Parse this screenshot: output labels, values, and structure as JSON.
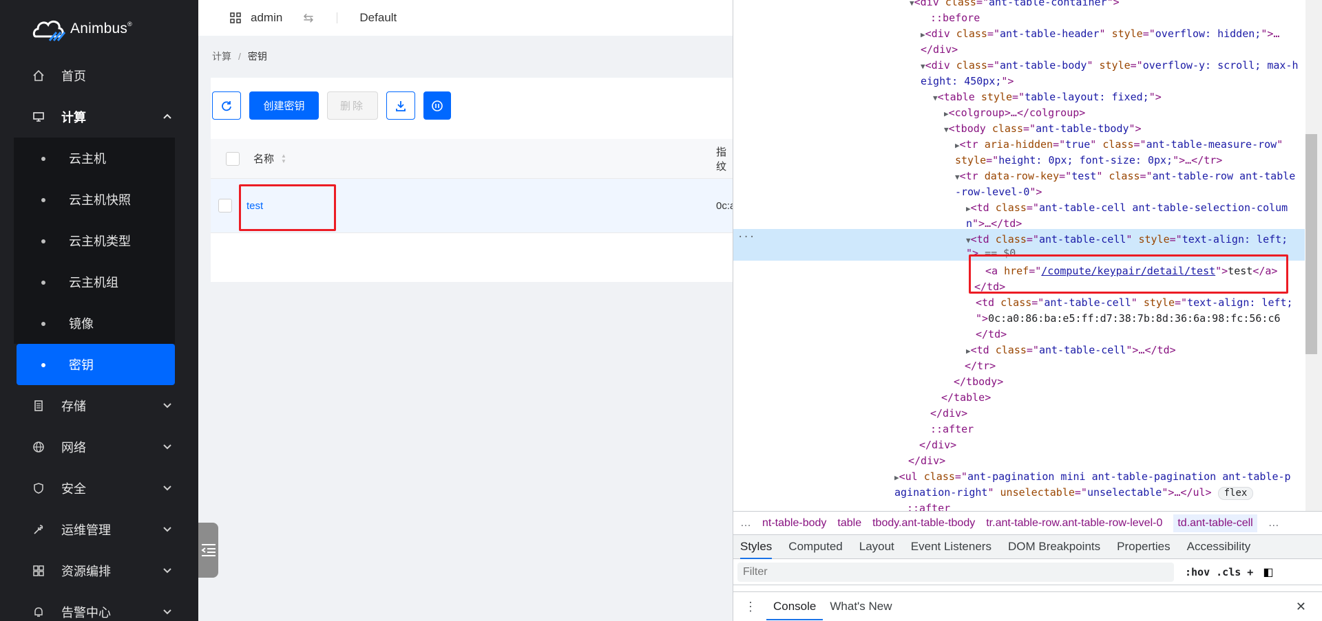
{
  "brand": {
    "name": "Animbus",
    "mark": "®"
  },
  "sidebar": {
    "items": [
      {
        "label": "首页",
        "icon": "home-icon"
      },
      {
        "label": "计算",
        "icon": "desktop-icon",
        "expanded": true
      },
      {
        "label": "存储",
        "icon": "storage-icon"
      },
      {
        "label": "网络",
        "icon": "globe-icon"
      },
      {
        "label": "安全",
        "icon": "shield-icon"
      },
      {
        "label": "运维管理",
        "icon": "wrench-icon"
      },
      {
        "label": "资源编排",
        "icon": "grid-icon"
      },
      {
        "label": "告警中心",
        "icon": "bell-icon"
      }
    ],
    "compute_sub": [
      "云主机",
      "云主机快照",
      "云主机类型",
      "云主机组",
      "镜像",
      "密钥"
    ],
    "active_sub": "密钥"
  },
  "header": {
    "user": "admin",
    "project": "Default"
  },
  "breadcrumb": {
    "parent": "计算",
    "separator": "/",
    "current": "密钥"
  },
  "toolbar": {
    "create_label": "创建密钥",
    "delete_label": "删除"
  },
  "table": {
    "columns": {
      "name": "名称",
      "fingerprint_partial": "指纹"
    },
    "rows": [
      {
        "name": "test",
        "fingerprint_partial": "0c:a"
      }
    ]
  },
  "devtools": {
    "elements": {
      "l1_class": "ant-table-container",
      "before": "::before",
      "header_class": "ant-table-header",
      "header_style": "overflow: hidden;",
      "close_div": "</div>",
      "body_class": "ant-table-body",
      "body_style_a": "overflow-y: scroll; max-h",
      "body_style_b": "eight: 450px;",
      "table_style": "table-layout: fixed;",
      "colgroup": "<colgroup>…</colgroup>",
      "tbody_class": "ant-table-tbody",
      "tr_aria": "true",
      "tr_class_a": "ant-table-measure-row",
      "tr_style": "height: 0px; font-size: 0px;",
      "row_key": "test",
      "row_class_a": "ant-table-row ant-table",
      "row_class_b": "-row-level-0",
      "td_sel_a": "ant-table-cell ant-table-selection-colum",
      "td_sel_b": "n",
      "td_cell": "ant-table-cell",
      "td_style": "text-align: left;",
      "eq_ref": "== $0",
      "href": "/compute/keypair/detail/test",
      "link_text": "test",
      "fingerprint": "0c:a0:86:ba:e5:ff:d7:38:7b:8d:36:6a:98:fc:56:c6",
      "after": "::after",
      "pag_class_a": "ant-pagination mini ant-table-pagination ant-table-p",
      "pag_class_b": "agination-right",
      "unselectable": "unselectable",
      "flex_badge": "flex"
    },
    "crumbs": [
      "…",
      "nt-table-body",
      "table",
      "tbody.ant-table-tbody",
      "tr.ant-table-row.ant-table-row-level-0",
      "td.ant-table-cell",
      "…"
    ],
    "tabs": [
      "Styles",
      "Computed",
      "Layout",
      "Event Listeners",
      "DOM Breakpoints",
      "Properties",
      "Accessibility"
    ],
    "filter_placeholder": "Filter",
    "filter_tools": ":hov  .cls  +",
    "drawer_tabs": [
      "Console",
      "What's New"
    ]
  },
  "colors": {
    "accent": "#0068ff",
    "sidebar_bg": "#1f2024",
    "highlight": "#ec1c24"
  }
}
